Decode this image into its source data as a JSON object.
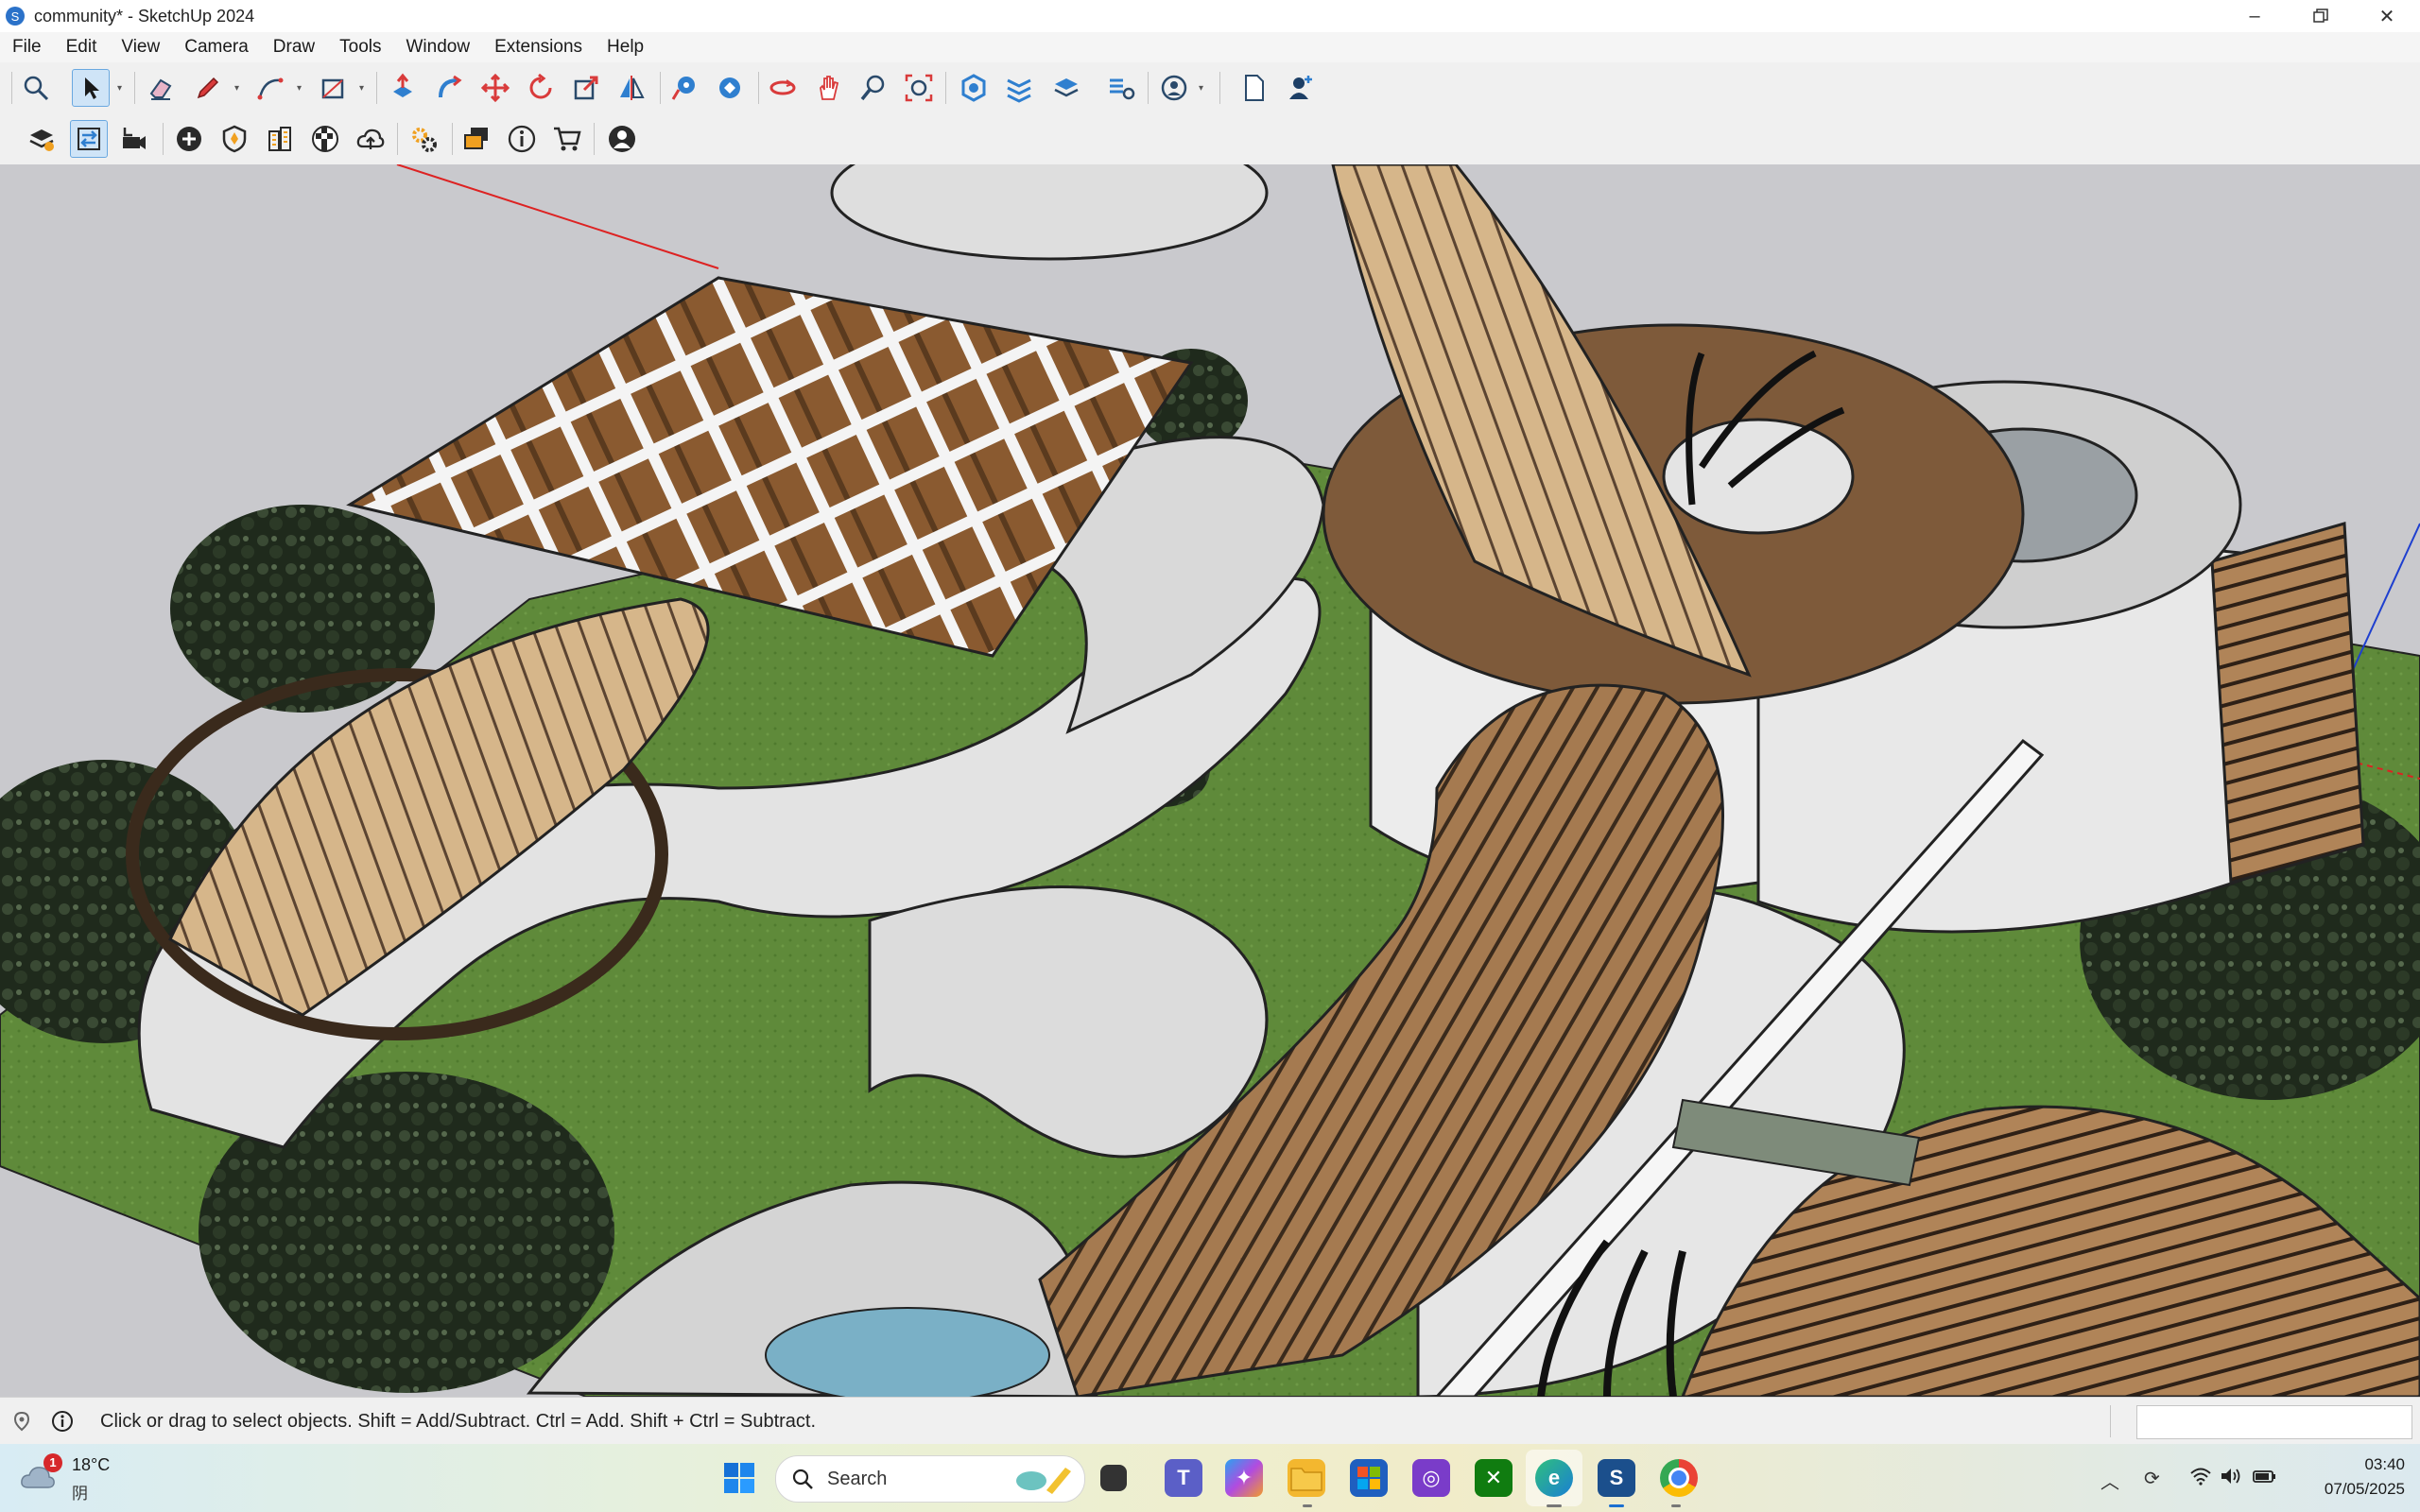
{
  "window": {
    "title": "community* - SketchUp 2024",
    "app_icon": "sketchup-icon",
    "controls": [
      "minimize-icon",
      "restore-icon",
      "close-icon"
    ]
  },
  "menu": {
    "items": [
      {
        "label": "File"
      },
      {
        "label": "Edit"
      },
      {
        "label": "View"
      },
      {
        "label": "Camera"
      },
      {
        "label": "Draw"
      },
      {
        "label": "Tools"
      },
      {
        "label": "Window"
      },
      {
        "label": "Extensions"
      },
      {
        "label": "Help"
      }
    ]
  },
  "toolbar_top": {
    "tools": [
      "zoom-icon",
      "select-icon",
      "eraser-icon",
      "pencil-line-icon",
      "arc-icon",
      "rectangle-icon",
      "push-pull-icon",
      "follow-me-icon",
      "move-icon",
      "rotate-icon",
      "scale-icon",
      "flip-icon",
      "tape-measure-icon",
      "paint-bucket-icon",
      "orbit-icon",
      "pan-icon",
      "zoom-magnify-icon",
      "zoom-extents-icon",
      "warehouse-icon",
      "section-plane-icon",
      "layers-icon",
      "styles-icon",
      "account-icon",
      "new-file-icon",
      "add-user-icon"
    ],
    "active": "select-icon"
  },
  "toolbar_second": {
    "tools": [
      "model-info-icon",
      "swap-icon",
      "camera-scene-icon",
      "add-circle-icon",
      "shield-icon",
      "building-icon",
      "checker-icon",
      "cloud-upload-icon",
      "settings-gears-icon",
      "components-icon",
      "info-icon",
      "cart-icon",
      "user-circle-icon"
    ],
    "active": "swap-icon"
  },
  "status": {
    "text": "Click or drag to select objects. Shift = Add/Subtract. Ctrl = Add. Shift + Ctrl = Subtract.",
    "measurements_value": ""
  },
  "taskbar": {
    "weather_temp": "18°C",
    "weather_desc": "阴",
    "weather_badge": "1",
    "search_placeholder": "Search",
    "time": "03:40",
    "date": "07/05/2025",
    "apps": [
      "windows-start-icon",
      "search-icon",
      "task-view-icon",
      "teams-icon",
      "copilot-icon",
      "file-explorer-icon",
      "store-icon",
      "photos-icon",
      "xbox-icon",
      "edge-icon",
      "sketchup-task-icon",
      "chrome-icon"
    ],
    "tray": [
      "chevron-up-icon",
      "sync-icon",
      "wifi-icon",
      "volume-icon",
      "battery-icon"
    ]
  },
  "colors": {
    "accent": "#2b72c9",
    "wood": "#8a6440",
    "grass": "#5f8a3a",
    "concrete": "#dcdcdc"
  }
}
